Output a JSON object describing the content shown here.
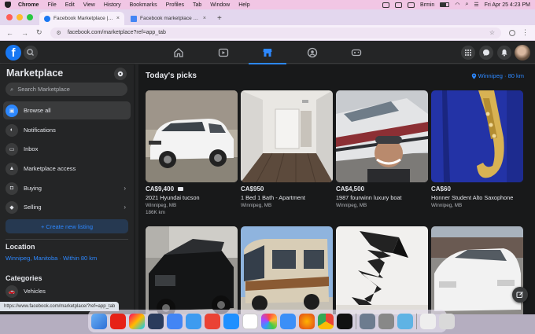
{
  "menubar": {
    "app_name": "Chrome",
    "items": [
      "File",
      "Edit",
      "View",
      "History",
      "Bookmarks",
      "Profiles",
      "Tab",
      "Window",
      "Help"
    ],
    "user": "Brmin",
    "datetime": "Fri Apr 25  4:23 PM"
  },
  "browser": {
    "tabs": [
      {
        "title": "Facebook Marketplace | Faceb",
        "active": true,
        "favicon_color": "#1877f2"
      },
      {
        "title": "Facebook marketplace blocke",
        "active": false,
        "favicon_color": "#4285f4"
      }
    ],
    "new_tab": "+",
    "url": "facebook.com/marketplace?ref=app_tab"
  },
  "fb": {
    "logo": "f",
    "nav_tabs": [
      "home-icon",
      "video-icon",
      "marketplace-icon",
      "groups-icon",
      "gaming-icon"
    ]
  },
  "sidebar": {
    "title": "Marketplace",
    "search_placeholder": "Search Marketplace",
    "items": [
      {
        "label": "Browse all",
        "icon": "store-icon",
        "active": true,
        "chevron": false
      },
      {
        "label": "Notifications",
        "icon": "bell-icon",
        "active": false,
        "chevron": false
      },
      {
        "label": "Inbox",
        "icon": "inbox-icon",
        "active": false,
        "chevron": false
      },
      {
        "label": "Marketplace access",
        "icon": "alert-icon",
        "active": false,
        "chevron": false
      },
      {
        "label": "Buying",
        "icon": "bag-icon",
        "active": false,
        "chevron": true
      },
      {
        "label": "Selling",
        "icon": "tag-icon",
        "active": false,
        "chevron": true
      }
    ],
    "create_label": "+ Create new listing",
    "location_heading": "Location",
    "location_value": "Winnipeg, Manitoba · Within 80 km",
    "categories_heading": "Categories",
    "categories": [
      {
        "label": "Vehicles",
        "icon": "car-icon"
      }
    ],
    "status_url": "https://www.facebook.com/marketplace/?ref=app_tab"
  },
  "main": {
    "title": "Today's picks",
    "location_link": "Winnipeg · 80 km",
    "listings": [
      {
        "price": "CA$9,400",
        "title": "2021 Hyundai tucson",
        "location": "Winnipeg, MB",
        "extra": "186K km",
        "video": true
      },
      {
        "price": "CA$950",
        "title": "1 Bed 1 Bath - Apartment",
        "location": "Winnipeg, MB",
        "extra": "",
        "video": false
      },
      {
        "price": "CA$4,500",
        "title": "1987 fourwinn luxury boat",
        "location": "Winnipeg, MB",
        "extra": "",
        "video": false
      },
      {
        "price": "CA$60",
        "title": "Honner Student Alto Saxophone",
        "location": "Winnipeg, MB",
        "extra": "",
        "video": false
      },
      {
        "price": "",
        "title": "",
        "location": "",
        "extra": "",
        "video": false
      },
      {
        "price": "",
        "title": "",
        "location": "",
        "extra": "",
        "video": false
      },
      {
        "price": "",
        "title": "",
        "location": "",
        "extra": "",
        "video": false
      },
      {
        "price": "",
        "title": "",
        "location": "",
        "extra": "",
        "video": false
      }
    ]
  },
  "colors": {
    "accent": "#2d88ff",
    "fb_blue": "#1877f2",
    "bg": "#18191a",
    "surface": "#242526"
  }
}
